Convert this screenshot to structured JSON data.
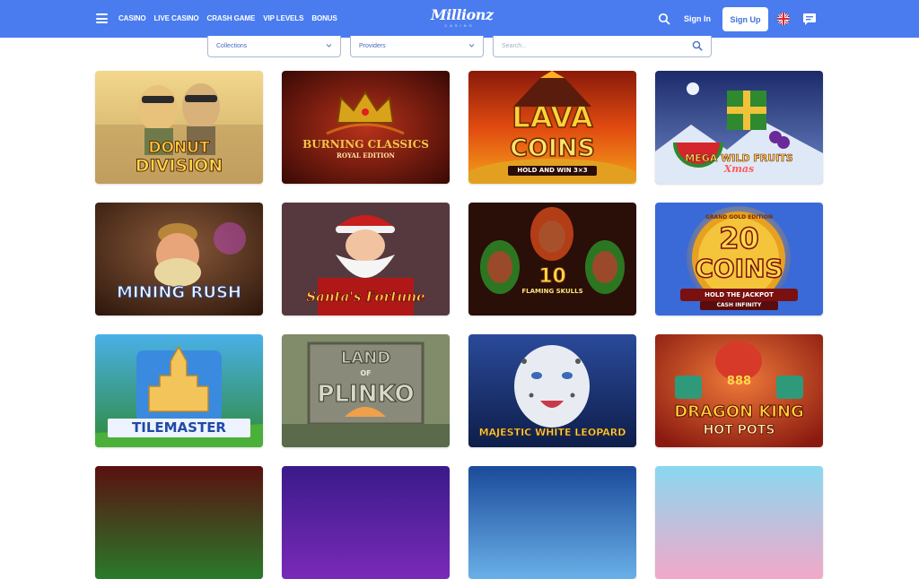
{
  "header": {
    "nav": [
      "CASINO",
      "LIVE CASINO",
      "CRASH GAME",
      "VIP LEVELS",
      "BONUS"
    ],
    "logo": "Millionz",
    "logo_sub": "CASINO",
    "signin_label": "Sign In",
    "signup_label": "Sign Up",
    "icons": {
      "menu": "hamburger-icon",
      "search": "search-icon",
      "language": "uk-flag-icon",
      "chat": "chat-icon"
    },
    "colors": {
      "bar": "#4a7cf0",
      "signup_text": "#3f6fe0"
    }
  },
  "filters": {
    "collections": "Collections",
    "providers": "Providers",
    "search_placeholder": "Search..."
  },
  "games": [
    {
      "line1": "DONUT",
      "line2": "DIVISION"
    },
    {
      "line1": "BURNING CLASSICS",
      "line2": "ROYAL EDITION"
    },
    {
      "line1": "LAVA",
      "line2": "COINS",
      "line3": "HOLD AND WIN 3×3"
    },
    {
      "line1": "MEGA WILD FRUITS",
      "line2": "Xmas"
    },
    {
      "line1": "MINING RUSH"
    },
    {
      "line1": "Santa's Fortune"
    },
    {
      "line1": "10",
      "line2": "FLAMING SKULLS"
    },
    {
      "line0": "GRAND GOLD EDITION",
      "line1": "20",
      "line2": "COINS",
      "line3": "HOLD THE JACKPOT",
      "line4": "CASH INFINITY"
    },
    {
      "line1": "TILEMASTER"
    },
    {
      "line1": "LAND",
      "line2": "PLINKO",
      "line3": "OF"
    },
    {
      "line1": "MAJESTIC WHITE LEOPARD"
    },
    {
      "line1": "DRAGON KING",
      "line2": "HOT POTS",
      "line3": "888"
    }
  ]
}
